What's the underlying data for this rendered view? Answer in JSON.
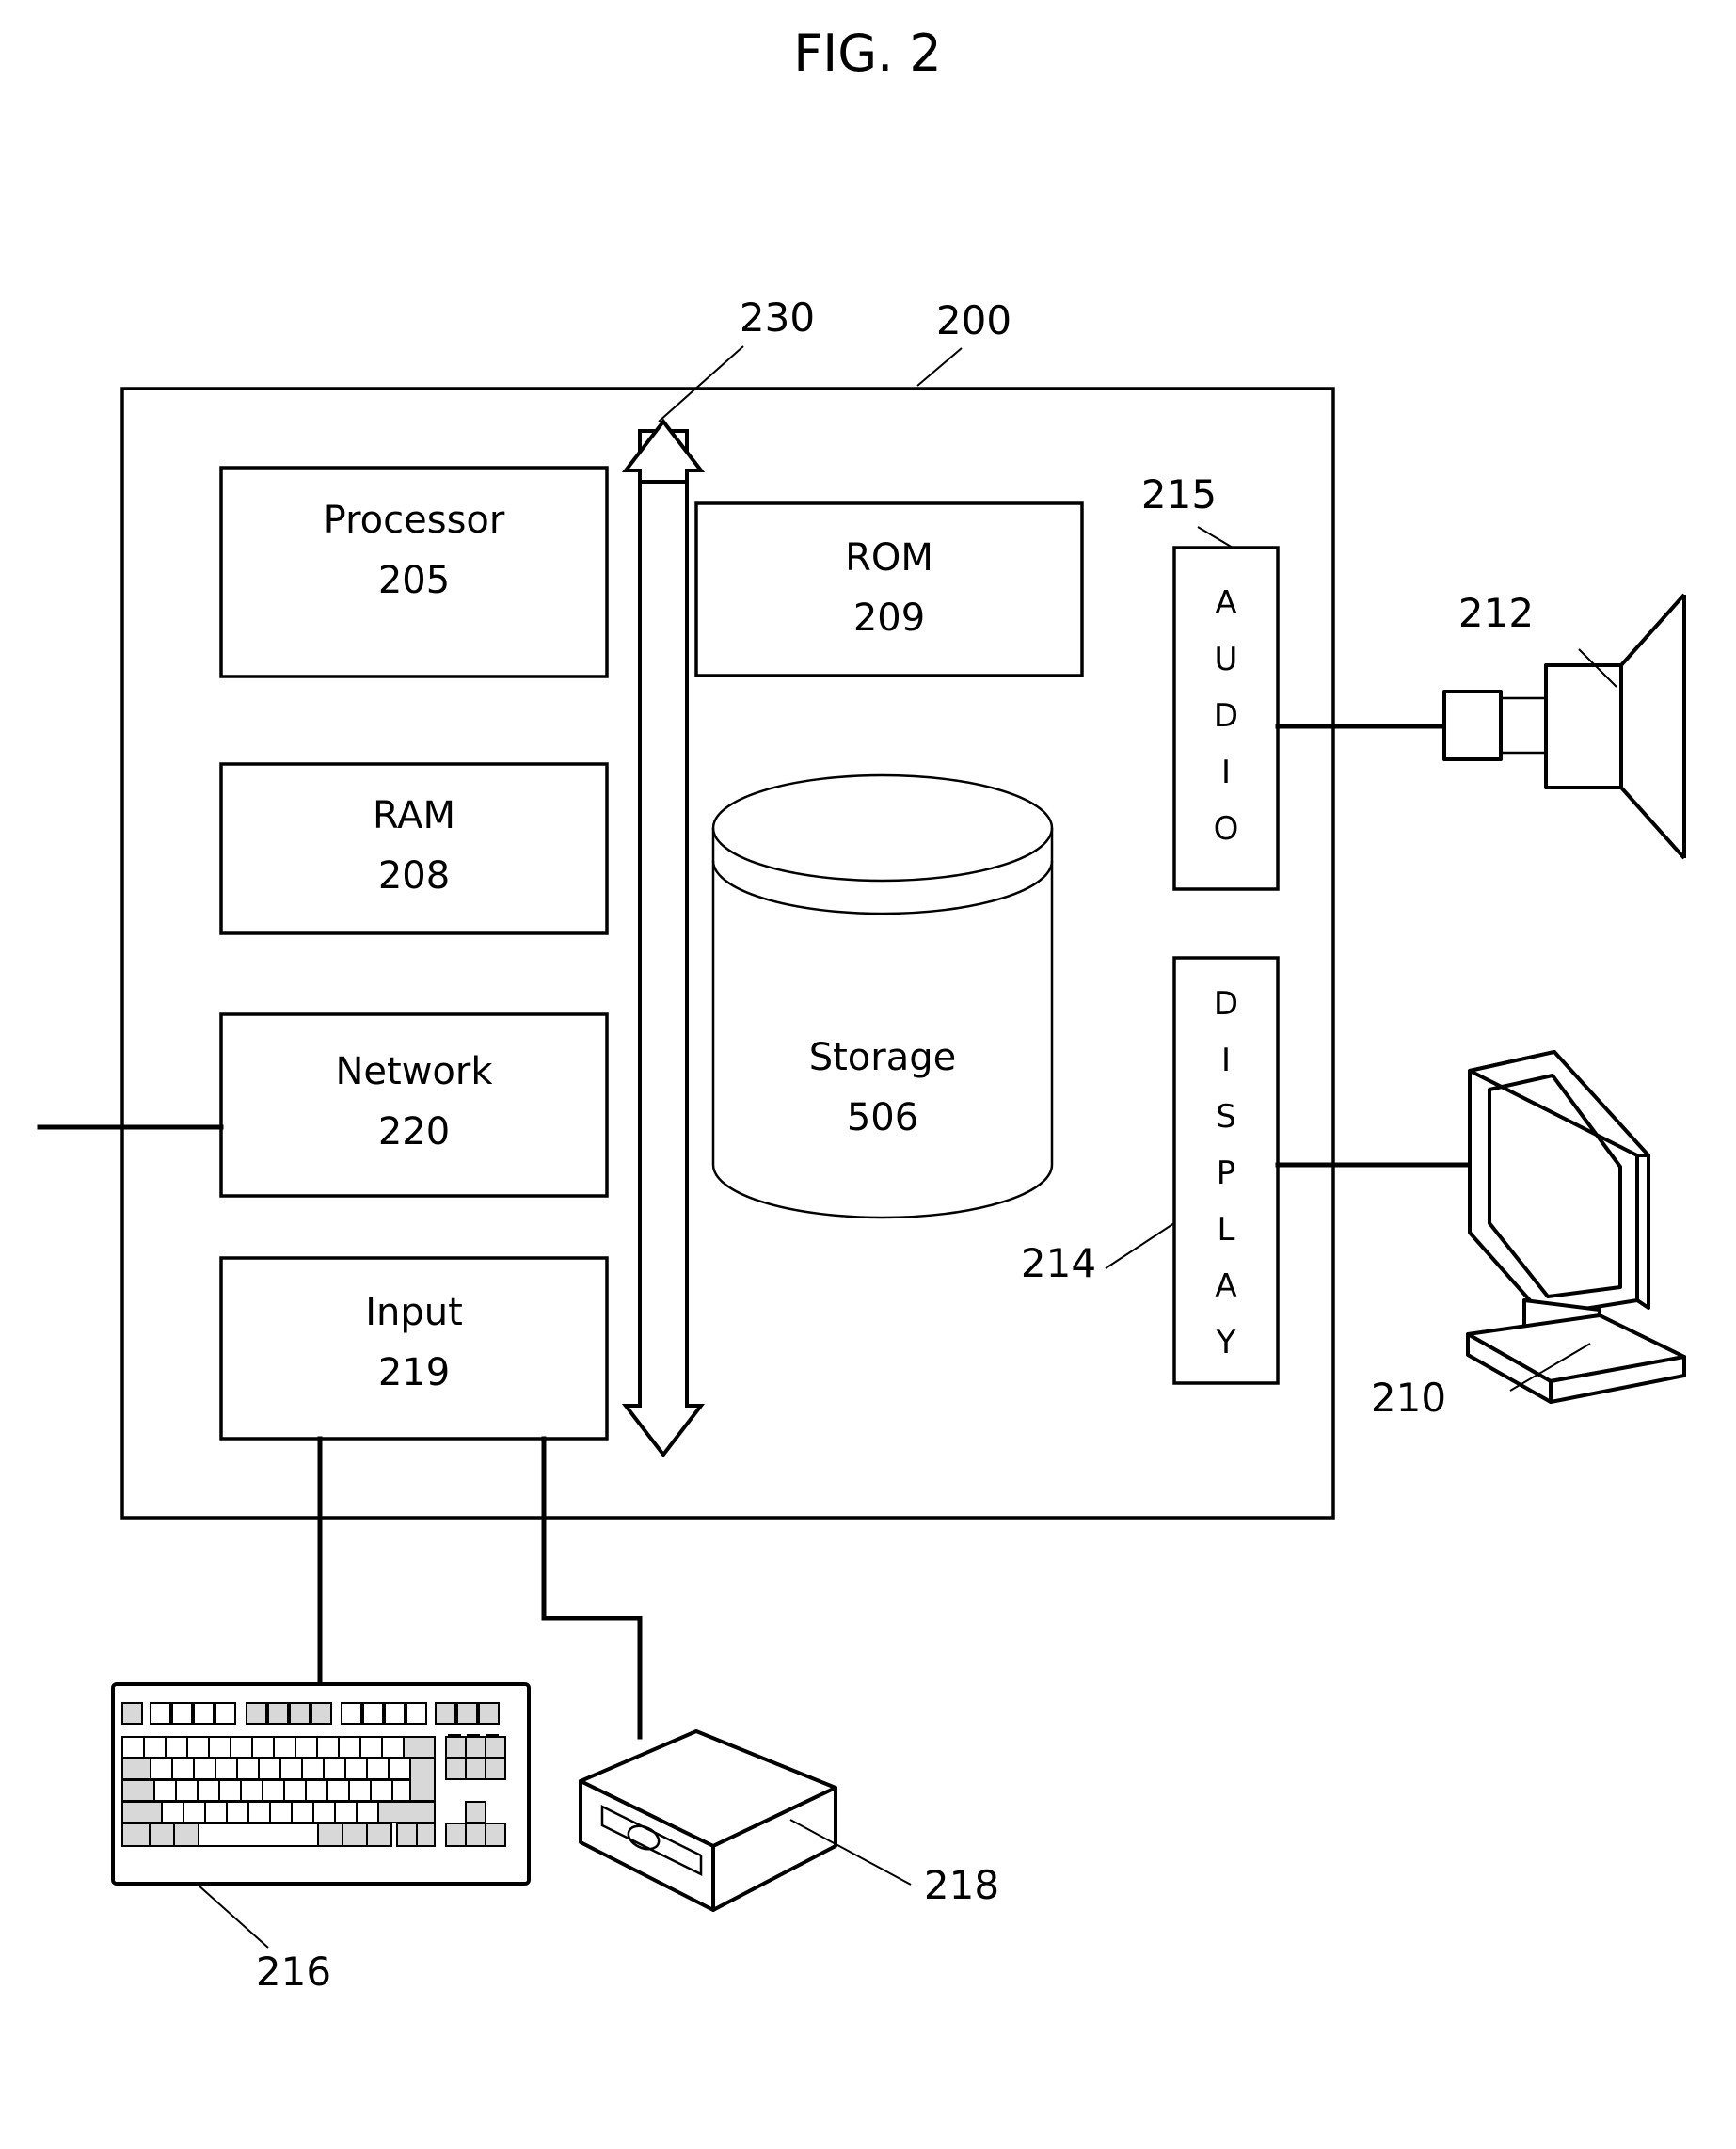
{
  "figure": {
    "title": "FIG. 2",
    "system_ref": "200",
    "bus_ref": "230"
  },
  "blocks": {
    "processor": {
      "name": "Processor",
      "ref": "205"
    },
    "ram": {
      "name": "RAM",
      "ref": "208"
    },
    "network": {
      "name": "Network",
      "ref": "220"
    },
    "input": {
      "name": "Input",
      "ref": "219"
    },
    "rom": {
      "name": "ROM",
      "ref": "209"
    },
    "storage": {
      "name": "Storage",
      "ref": "506"
    },
    "audio": {
      "name": "AUDIO",
      "ref": "215",
      "letters": [
        "A",
        "U",
        "D",
        "I",
        "O"
      ]
    },
    "display": {
      "name": "DISPLAY",
      "ref": "214",
      "letters": [
        "D",
        "I",
        "S",
        "P",
        "L",
        "A",
        "Y"
      ]
    }
  },
  "peripherals": {
    "speaker": {
      "name": "speaker",
      "ref": "212"
    },
    "monitor": {
      "name": "monitor",
      "ref": "210"
    },
    "keyboard": {
      "name": "keyboard",
      "ref": "216"
    },
    "mouse": {
      "name": "pointing device",
      "ref": "218"
    }
  },
  "colors": {
    "line": "#000000",
    "background": "#ffffff",
    "key_shaded": "#d8d8d8"
  }
}
